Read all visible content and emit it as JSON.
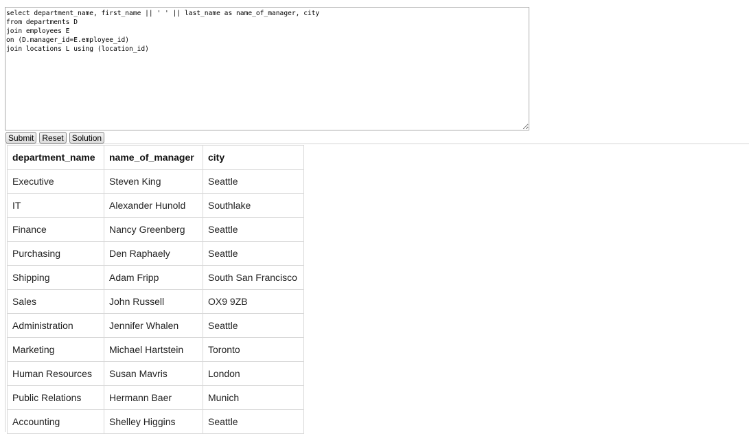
{
  "editor": {
    "sql": "select department_name, first_name || ' ' || last_name as name_of_manager, city\nfrom departments D\njoin employees E\non (D.manager_id=E.employee_id)\njoin locations L using (location_id)"
  },
  "buttons": {
    "submit_label": "Submit",
    "reset_label": "Reset",
    "solution_label": "Solution"
  },
  "results": {
    "columns": [
      "department_name",
      "name_of_manager",
      "city"
    ],
    "rows": [
      [
        "Executive",
        "Steven King",
        "Seattle"
      ],
      [
        "IT",
        "Alexander Hunold",
        "Southlake"
      ],
      [
        "Finance",
        "Nancy Greenberg",
        "Seattle"
      ],
      [
        "Purchasing",
        "Den Raphaely",
        "Seattle"
      ],
      [
        "Shipping",
        "Adam Fripp",
        "South San Francisco"
      ],
      [
        "Sales",
        "John Russell",
        "OX9 9ZB"
      ],
      [
        "Administration",
        "Jennifer Whalen",
        "Seattle"
      ],
      [
        "Marketing",
        "Michael Hartstein",
        "Toronto"
      ],
      [
        "Human Resources",
        "Susan Mavris",
        "London"
      ],
      [
        "Public Relations",
        "Hermann Baer",
        "Munich"
      ],
      [
        "Accounting",
        "Shelley Higgins",
        "Seattle"
      ]
    ]
  }
}
